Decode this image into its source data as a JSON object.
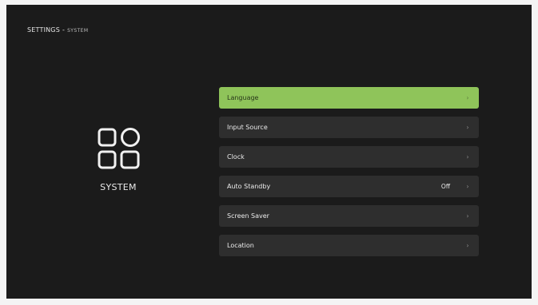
{
  "header": {
    "title": "SETTINGS",
    "separator": "-",
    "subtitle": "SYSTEM"
  },
  "category": {
    "icon": "apps-grid-icon",
    "label": "SYSTEM"
  },
  "menu": {
    "items": [
      {
        "label": "Language",
        "value": "",
        "selected": true
      },
      {
        "label": "Input Source",
        "value": "",
        "selected": false
      },
      {
        "label": "Clock",
        "value": "",
        "selected": false
      },
      {
        "label": "Auto Standby",
        "value": "Off",
        "selected": false
      },
      {
        "label": "Screen Saver",
        "value": "",
        "selected": false
      },
      {
        "label": "Location",
        "value": "",
        "selected": false
      }
    ]
  },
  "colors": {
    "background": "#1b1b1b",
    "row": "#2e2e2e",
    "selected_row": "#8fc45a",
    "text": "#e8e8e8"
  }
}
